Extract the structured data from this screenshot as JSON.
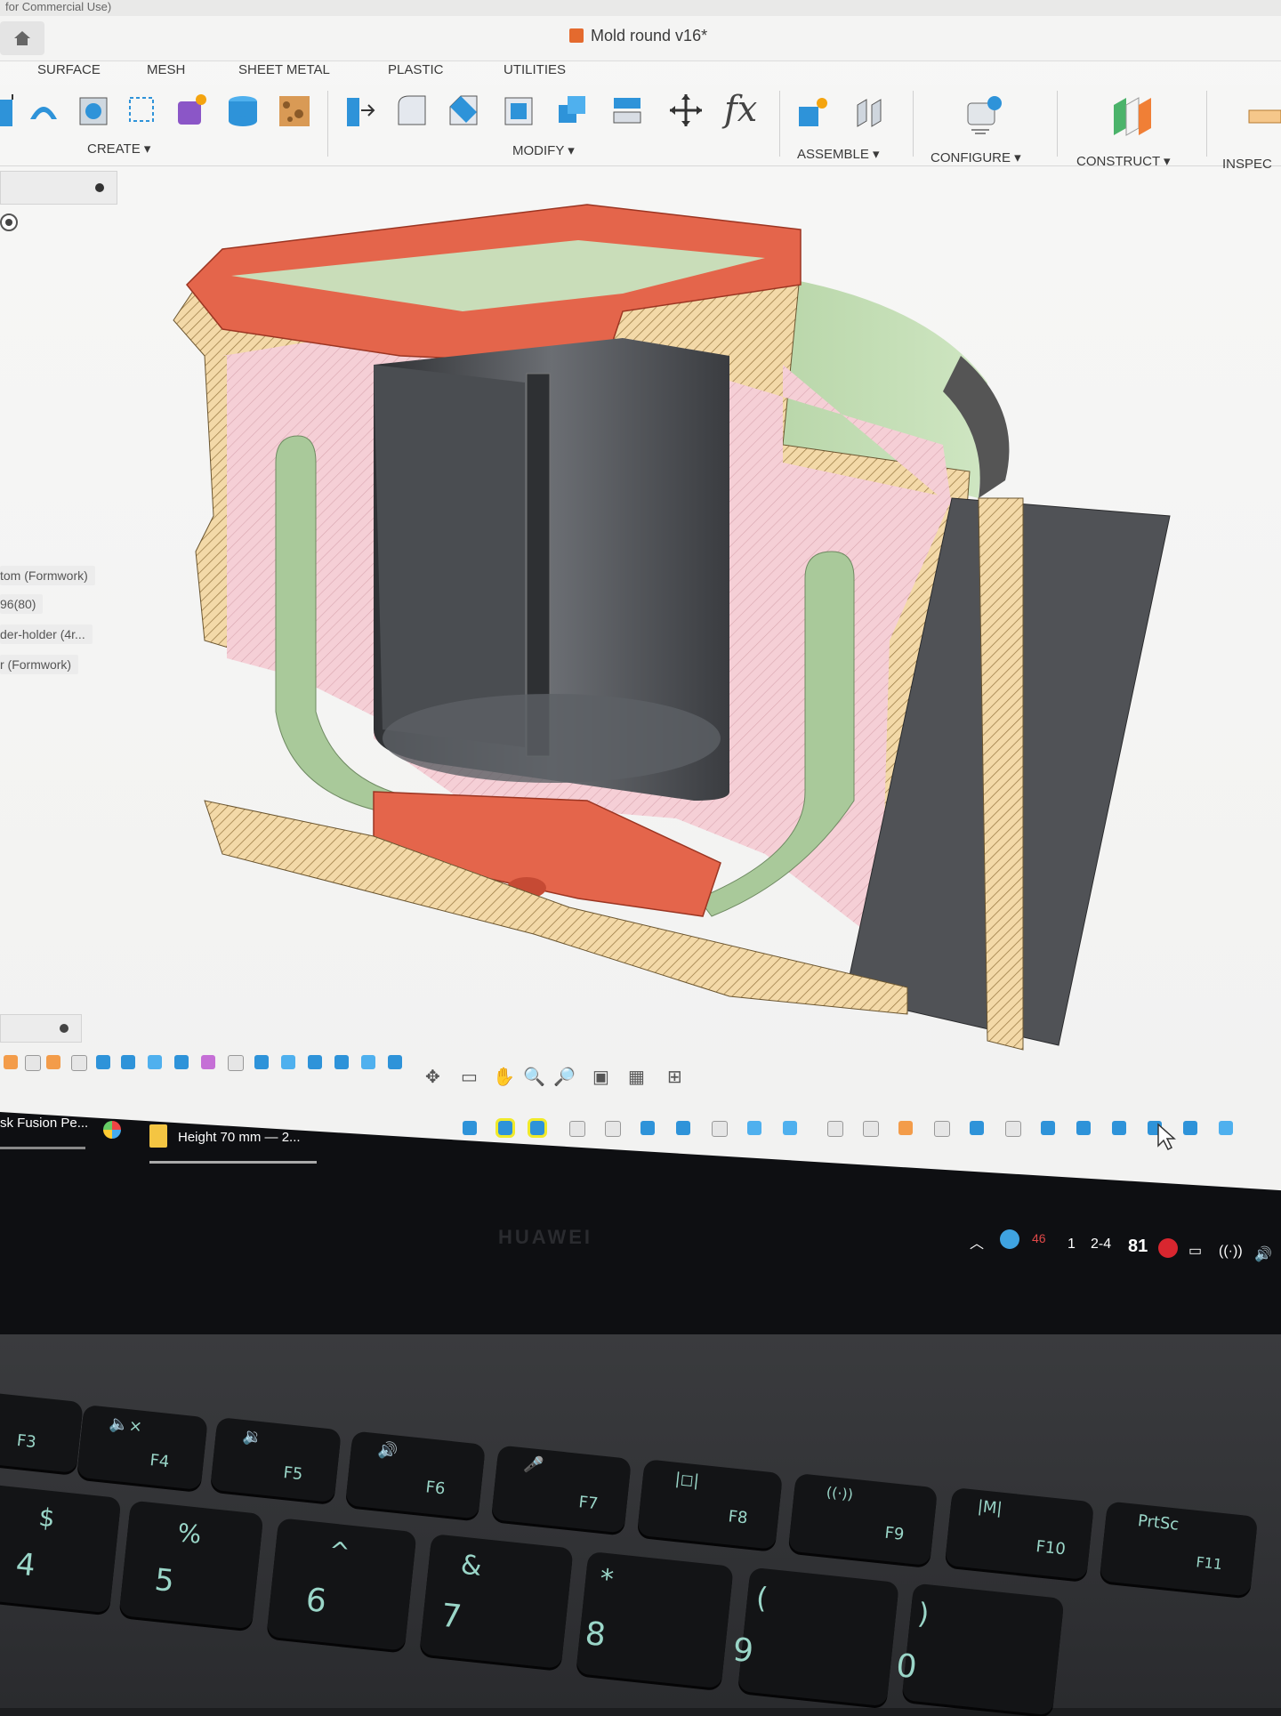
{
  "app": {
    "top_strip": "for Commercial Use)",
    "document_title": "Mold round v16*"
  },
  "toolbar": {
    "tabs": [
      "SURFACE",
      "MESH",
      "SHEET METAL",
      "PLASTIC",
      "UTILITIES"
    ],
    "groups": {
      "create": "CREATE ▾",
      "modify": "MODIFY ▾",
      "assemble": "ASSEMBLE ▾",
      "configure": "CONFIGURE ▾",
      "construct": "CONSTRUCT ▾",
      "inspect": "INSPEC"
    },
    "fx_label": "fx"
  },
  "browser": {
    "items": [
      "tom (Formwork)",
      "96(80)",
      "der-holder (4r...",
      "r (Formwork)"
    ]
  },
  "taskbar": {
    "apps": [
      "sk Fusion Pe...",
      "Height 70 mm — 2..."
    ]
  },
  "tray": {
    "badge": "46",
    "value1": "1",
    "value2": "2-4",
    "value3": "81"
  },
  "laptop": {
    "brand": "HUAWEI"
  },
  "keys": [
    {
      "main": "F3",
      "sub": ""
    },
    {
      "main": "F4",
      "sub": "🔈×"
    },
    {
      "main": "F5",
      "sub": "🔉"
    },
    {
      "main": "F6",
      "sub": "🔊"
    },
    {
      "main": "F7",
      "sub": "🎤"
    },
    {
      "main": "F8",
      "sub": "|◻|"
    },
    {
      "main": "F9",
      "sub": "((·))"
    },
    {
      "main": "F10",
      "sub": "|M|"
    },
    {
      "main": "F11",
      "sub": "PrtSc"
    }
  ],
  "number_keys": [
    {
      "top": "$",
      "bottom": "4"
    },
    {
      "top": "%",
      "bottom": "5"
    },
    {
      "top": "^",
      "bottom": "6"
    },
    {
      "top": "&",
      "bottom": "7"
    },
    {
      "top": "*",
      "bottom": "8"
    },
    {
      "top": "(",
      "bottom": "9"
    },
    {
      "top": ")",
      "bottom": "0"
    }
  ],
  "colors": {
    "section_hatch": "#f5d9a6",
    "pink_body": "#f2c4cc",
    "green_body": "#b9d7a8",
    "orange_body": "#e86a4e",
    "dark_surface": "#4a4c50",
    "ribbon_blue": "#2e93d9"
  }
}
